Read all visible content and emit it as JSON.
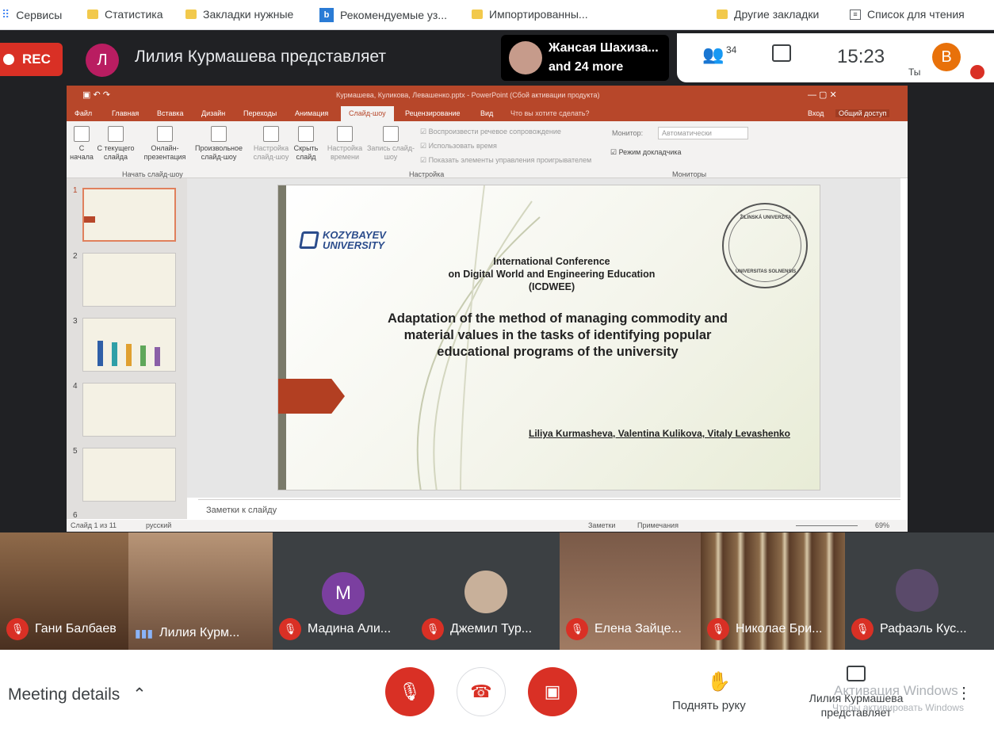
{
  "bookmarks": {
    "services": "Сервисы",
    "stats": "Статистика",
    "needed": "Закладки нужные",
    "recommended": "Рекомендуемые уз...",
    "imported": "Импортированны...",
    "other": "Другие закладки",
    "reading": "Список для чтения"
  },
  "meet": {
    "rec": "REC",
    "presenter_initial": "Л",
    "presenting": "Лилия Курмашева представляет",
    "top_name": "Жансая Шахиза...",
    "top_more": "and 24 more",
    "people_count": "34",
    "time": "15:23",
    "self_initial": "В",
    "self_label": "Ты"
  },
  "ppt": {
    "title": "Курмашева, Куликова, Левашенко.pptx - PowerPoint (Сбой активации продукта)",
    "signin": "Вход",
    "share": "Общий доступ",
    "tabs": [
      "Файл",
      "Главная",
      "Вставка",
      "Дизайн",
      "Переходы",
      "Анимация",
      "Слайд-шоу",
      "Рецензирование",
      "Вид",
      "Что вы хотите сделать?"
    ],
    "rb": {
      "from_start": "С начала",
      "from_current": "С текущего слайда",
      "online": "Онлайн-презентация",
      "custom": "Произвольное слайд-шоу",
      "setup": "Настройка слайд-шоу",
      "hide": "Скрыть слайд",
      "rehearse": "Настройка времени",
      "record": "Запись слайд-шоу",
      "group1": "Начать слайд-шоу",
      "group2": "Настройка",
      "group3": "Мониторы",
      "chk1": "Воспроизвести речевое сопровождение",
      "chk2": "Использовать время",
      "chk3": "Показать элементы управления проигрывателем",
      "monitor_label": "Монитор:",
      "monitor_value": "Автоматически",
      "presenter_view": "Режим докладчика"
    },
    "thumb_nums": [
      "1",
      "2",
      "3",
      "4",
      "5",
      "6"
    ],
    "slide": {
      "logo_line1": "KOZYBAYEV",
      "logo_line2": "UNIVERSITY",
      "conf1": "International Conference",
      "conf2": "on Digital World  and Engineering Education",
      "conf3": "(ICDWEE)",
      "t1": "Adaptation of the method of managing commodity and",
      "t2": "material values in the tasks of identifying popular",
      "t3": "educational programs of the university",
      "authors": "Liliya Kurmasheva, Valentina Kulikova, Vitaly Levashenko",
      "seal_top": "ŽILINSKÁ UNIVERZITA",
      "seal_bottom": "UNIVERSITAS SOLNENSIS"
    },
    "notes": "Заметки к слайду",
    "status": {
      "slide": "Слайд 1 из 11",
      "lang": "русский",
      "notes": "Заметки",
      "comments": "Примечания",
      "zoom": "69%"
    }
  },
  "tiles": [
    {
      "name": "Гани Балбаев"
    },
    {
      "name": "Лилия Курм..."
    },
    {
      "name": "Мадина Али...",
      "initial": "М"
    },
    {
      "name": "Джемил Тур..."
    },
    {
      "name": "Елена Зайце..."
    },
    {
      "name": "Николае Бри..."
    },
    {
      "name": "Рафаэль Кус..."
    }
  ],
  "bottom": {
    "details": "Meeting details",
    "raise": "Поднять руку",
    "presenting_line1": "Лилия Курмашева",
    "presenting_line2": "представляет",
    "win1": "Активация Windows",
    "win2": "Чтобы активировать Windows"
  },
  "colors": {
    "red": "#d93025",
    "ppt": "#b7472a",
    "dark": "#202124"
  }
}
